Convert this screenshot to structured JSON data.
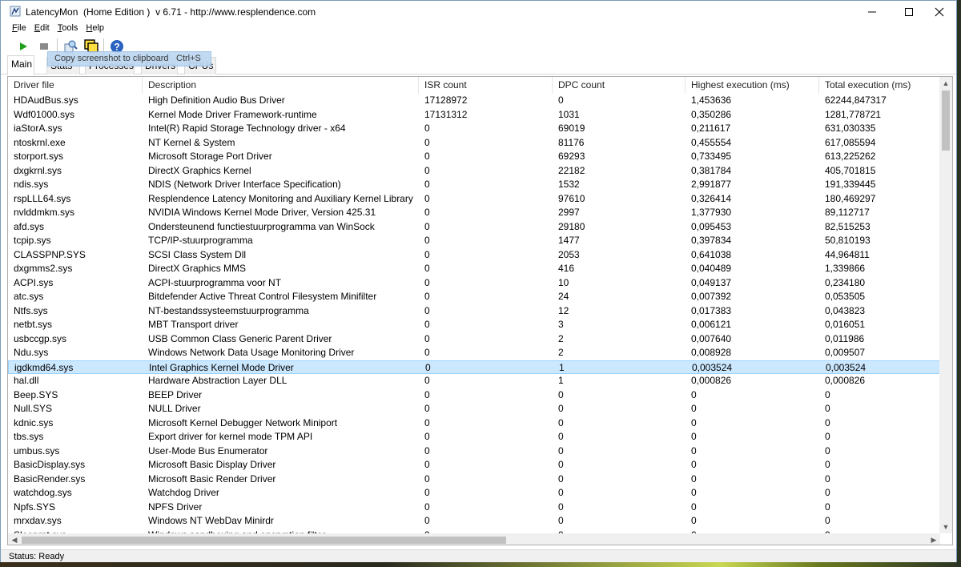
{
  "window": {
    "title": "LatencyMon  (Home Edition )  v 6.71 - http://www.resplendence.com"
  },
  "menu": [
    {
      "prefix": "",
      "mnemonic": "F",
      "rest": "ile"
    },
    {
      "prefix": "",
      "mnemonic": "E",
      "rest": "dit"
    },
    {
      "prefix": "",
      "mnemonic": "T",
      "rest": "ools"
    },
    {
      "prefix": "",
      "mnemonic": "H",
      "rest": "elp"
    }
  ],
  "toolbar": {
    "icons": [
      "play-icon",
      "stop-icon",
      "report-icon",
      "screenshot-icon",
      "help-icon"
    ]
  },
  "tabs": [
    "Main",
    "Stats",
    "Processes",
    "Drivers",
    "CPUs"
  ],
  "popup": {
    "label": "Copy screenshot to clipboard",
    "shortcut": "Ctrl+S"
  },
  "table": {
    "columns": [
      "Driver file",
      "Description",
      "ISR count",
      "DPC count",
      "Highest execution (ms)",
      "Total execution (ms)"
    ],
    "rows": [
      [
        "HDAudBus.sys",
        "High Definition Audio Bus Driver",
        "17128972",
        "0",
        "1,453636",
        "62244,847317"
      ],
      [
        "Wdf01000.sys",
        "Kernel Mode Driver Framework-runtime",
        "17131312",
        "1031",
        "0,350286",
        "1281,778721"
      ],
      [
        "iaStorA.sys",
        "Intel(R) Rapid Storage Technology driver - x64",
        "0",
        "69019",
        "0,211617",
        "631,030335"
      ],
      [
        "ntoskrnl.exe",
        "NT Kernel & System",
        "0",
        "81176",
        "0,455554",
        "617,085594"
      ],
      [
        "storport.sys",
        "Microsoft Storage Port Driver",
        "0",
        "69293",
        "0,733495",
        "613,225262"
      ],
      [
        "dxgkrnl.sys",
        "DirectX Graphics Kernel",
        "0",
        "22182",
        "0,381784",
        "405,701815"
      ],
      [
        "ndis.sys",
        "NDIS (Network Driver Interface Specification)",
        "0",
        "1532",
        "2,991877",
        "191,339445"
      ],
      [
        "rspLLL64.sys",
        "Resplendence Latency Monitoring and Auxiliary Kernel Library",
        "0",
        "97610",
        "0,326414",
        "180,469297"
      ],
      [
        "nvlddmkm.sys",
        "NVIDIA Windows Kernel Mode Driver, Version 425.31",
        "0",
        "2997",
        "1,377930",
        "89,112717"
      ],
      [
        "afd.sys",
        "Ondersteunend functiestuurprogramma van WinSock",
        "0",
        "29180",
        "0,095453",
        "82,515253"
      ],
      [
        "tcpip.sys",
        "TCP/IP-stuurprogramma",
        "0",
        "1477",
        "0,397834",
        "50,810193"
      ],
      [
        "CLASSPNP.SYS",
        "SCSI Class System Dll",
        "0",
        "2053",
        "0,641038",
        "44,964811"
      ],
      [
        "dxgmms2.sys",
        "DirectX Graphics MMS",
        "0",
        "416",
        "0,040489",
        "1,339866"
      ],
      [
        "ACPI.sys",
        "ACPI-stuurprogramma voor NT",
        "0",
        "10",
        "0,049137",
        "0,234180"
      ],
      [
        "atc.sys",
        "Bitdefender Active Threat Control Filesystem Minifilter",
        "0",
        "24",
        "0,007392",
        "0,053505"
      ],
      [
        "Ntfs.sys",
        "NT-bestandssysteemstuurprogramma",
        "0",
        "12",
        "0,017383",
        "0,043823"
      ],
      [
        "netbt.sys",
        "MBT Transport driver",
        "0",
        "3",
        "0,006121",
        "0,016051"
      ],
      [
        "usbccgp.sys",
        "USB Common Class Generic Parent Driver",
        "0",
        "2",
        "0,007640",
        "0,011986"
      ],
      [
        "Ndu.sys",
        "Windows Network Data Usage Monitoring Driver",
        "0",
        "2",
        "0,008928",
        "0,009507"
      ],
      [
        "igdkmd64.sys",
        "Intel Graphics Kernel Mode Driver",
        "0",
        "1",
        "0,003524",
        "0,003524"
      ],
      [
        "hal.dll",
        "Hardware Abstraction Layer DLL",
        "0",
        "1",
        "0,000826",
        "0,000826"
      ],
      [
        "Beep.SYS",
        "BEEP Driver",
        "0",
        "0",
        "0",
        "0"
      ],
      [
        "Null.SYS",
        "NULL Driver",
        "0",
        "0",
        "0",
        "0"
      ],
      [
        "kdnic.sys",
        "Microsoft Kernel Debugger Network Miniport",
        "0",
        "0",
        "0",
        "0"
      ],
      [
        "tbs.sys",
        "Export driver for kernel mode TPM API",
        "0",
        "0",
        "0",
        "0"
      ],
      [
        "umbus.sys",
        "User-Mode Bus Enumerator",
        "0",
        "0",
        "0",
        "0"
      ],
      [
        "BasicDisplay.sys",
        "Microsoft Basic Display Driver",
        "0",
        "0",
        "0",
        "0"
      ],
      [
        "BasicRender.sys",
        "Microsoft Basic Render Driver",
        "0",
        "0",
        "0",
        "0"
      ],
      [
        "watchdog.sys",
        "Watchdog Driver",
        "0",
        "0",
        "0",
        "0"
      ],
      [
        "Npfs.SYS",
        "NPFS Driver",
        "0",
        "0",
        "0",
        "0"
      ],
      [
        "mrxdav.sys",
        "Windows NT WebDav Minirdr",
        "0",
        "0",
        "0",
        "0"
      ],
      [
        "Sleeprnt.sys",
        "Windows sandboxing and encryption filter",
        "0",
        "0",
        "0",
        "0"
      ]
    ],
    "selected_row": 19
  },
  "status": "Status: Ready"
}
